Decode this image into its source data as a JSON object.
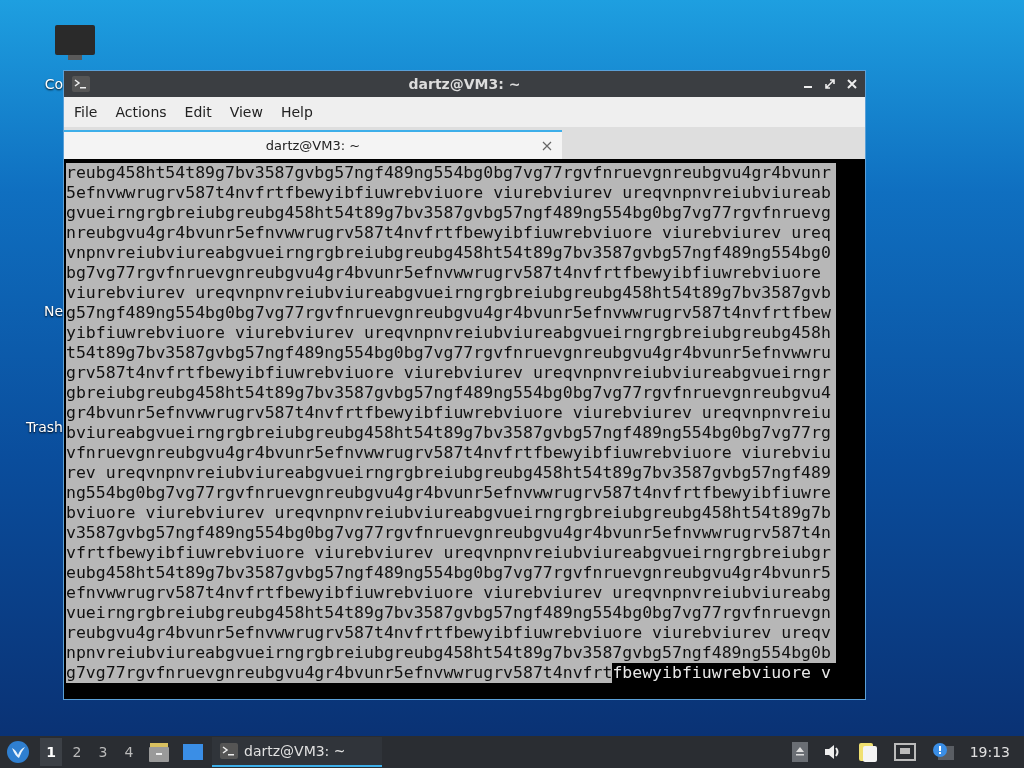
{
  "desktop": {
    "icons": [
      {
        "label": "Co",
        "kind": "monitor"
      },
      {
        "label": "Ne",
        "kind": "hidden"
      },
      {
        "label": "Trash",
        "kind": "hidden"
      }
    ]
  },
  "window": {
    "title": "dartz@VM3: ~",
    "menu": [
      "File",
      "Actions",
      "Edit",
      "View",
      "Help"
    ],
    "tabs": [
      {
        "label": "dartz@VM3: ~",
        "selected": true
      }
    ],
    "terminal": {
      "lines": [
        {
          "text": "reubg458ht54t89g7bv3587gvbg57ngf489ng554bg0bg7vg77rgvfnruevgnreubgvu4gr4bvunr",
          "selected": true
        },
        {
          "text": "5efnvwwrugrv587t4nvfrtfbewyibfiuwrebviuore viurebviurev ureqvnpnvreiubviureab",
          "selected": true
        },
        {
          "text": "gvueirngrgbreiubgreubg458ht54t89g7bv3587gvbg57ngf489ng554bg0bg7vg77rgvfnruevg",
          "selected": true
        },
        {
          "text": "nreubgvu4gr4bvunr5efnvwwrugrv587t4nvfrtfbewyibfiuwrebviuore viurebviurev ureq",
          "selected": true
        },
        {
          "text": "vnpnvreiubviureabgvueirngrgbreiubgreubg458ht54t89g7bv3587gvbg57ngf489ng554bg0",
          "selected": true
        },
        {
          "text": "bg7vg77rgvfnruevgnreubgvu4gr4bvunr5efnvwwrugrv587t4nvfrtfbewyibfiuwrebviuore",
          "selected": true
        },
        {
          "text": "viurebviurev ureqvnpnvreiubviureabgvueirngrgbreiubgreubg458ht54t89g7bv3587gvb",
          "selected": true
        },
        {
          "text": "g57ngf489ng554bg0bg7vg77rgvfnruevgnreubgvu4gr4bvunr5efnvwwrugrv587t4nvfrtfbew",
          "selected": true
        },
        {
          "text": "yibfiuwrebviuore viurebviurev ureqvnpnvreiubviureabgvueirngrgbreiubgreubg458h",
          "selected": true
        },
        {
          "text": "t54t89g7bv3587gvbg57ngf489ng554bg0bg7vg77rgvfnruevgnreubgvu4gr4bvunr5efnvwwru",
          "selected": true
        },
        {
          "text": "grv587t4nvfrtfbewyibfiuwrebviuore viurebviurev ureqvnpnvreiubviureabgvueirngr",
          "selected": true
        },
        {
          "text": "gbreiubgreubg458ht54t89g7bv3587gvbg57ngf489ng554bg0bg7vg77rgvfnruevgnreubgvu4",
          "selected": true
        },
        {
          "text": "gr4bvunr5efnvwwrugrv587t4nvfrtfbewyibfiuwrebviuore viurebviurev ureqvnpnvreiu",
          "selected": true
        },
        {
          "text": "bviureabgvueirngrgbreiubgreubg458ht54t89g7bv3587gvbg57ngf489ng554bg0bg7vg77rg",
          "selected": true
        },
        {
          "text": "vfnruevgnreubgvu4gr4bvunr5efnvwwrugrv587t4nvfrtfbewyibfiuwrebviuore viurebviu",
          "selected": true
        },
        {
          "text": "rev ureqvnpnvreiubviureabgvueirngrgbreiubgreubg458ht54t89g7bv3587gvbg57ngf489",
          "selected": true
        },
        {
          "text": "ng554bg0bg7vg77rgvfnruevgnreubgvu4gr4bvunr5efnvwwrugrv587t4nvfrtfbewyibfiuwre",
          "selected": true
        },
        {
          "text": "bviuore viurebviurev ureqvnpnvreiubviureabgvueirngrgbreiubgreubg458ht54t89g7b",
          "selected": true
        },
        {
          "text": "v3587gvbg57ngf489ng554bg0bg7vg77rgvfnruevgnreubgvu4gr4bvunr5efnvwwrugrv587t4n",
          "selected": true
        },
        {
          "text": "vfrtfbewyibfiuwrebviuore viurebviurev ureqvnpnvreiubviureabgvueirngrgbreiubgr",
          "selected": true
        },
        {
          "text": "eubg458ht54t89g7bv3587gvbg57ngf489ng554bg0bg7vg77rgvfnruevgnreubgvu4gr4bvunr5",
          "selected": true
        },
        {
          "text": "efnvwwrugrv587t4nvfrtfbewyibfiuwrebviuore viurebviurev ureqvnpnvreiubviureabg",
          "selected": true
        },
        {
          "text": "vueirngrgbreiubgreubg458ht54t89g7bv3587gvbg57ngf489ng554bg0bg7vg77rgvfnruevgn",
          "selected": true
        },
        {
          "text": "reubgvu4gr4bvunr5efnvwwrugrv587t4nvfrtfbewyibfiuwrebviuore viurebviurev ureqv",
          "selected": true
        },
        {
          "text": "npnvreiubviureabgvueirngrgbreiubgreubg458ht54t89g7bv3587gvbg57ngf489ng554bg0b",
          "selected": true
        },
        {
          "segments": [
            {
              "text": "g7vg77rgvfnruevgnreubgvu4gr4bvunr5efnvwwrugrv587t4nvfrt",
              "selected": true
            },
            {
              "text": "fbewyibfiuwrebviuore v",
              "selected": false
            }
          ]
        }
      ]
    }
  },
  "taskbar": {
    "workspaces": [
      {
        "label": "1",
        "selected": true
      },
      {
        "label": "2",
        "selected": false
      },
      {
        "label": "3",
        "selected": false
      },
      {
        "label": "4",
        "selected": false
      }
    ],
    "tasks": [
      {
        "title": "dartz@VM3: ~",
        "selected": true
      }
    ],
    "clock": "19:13"
  }
}
